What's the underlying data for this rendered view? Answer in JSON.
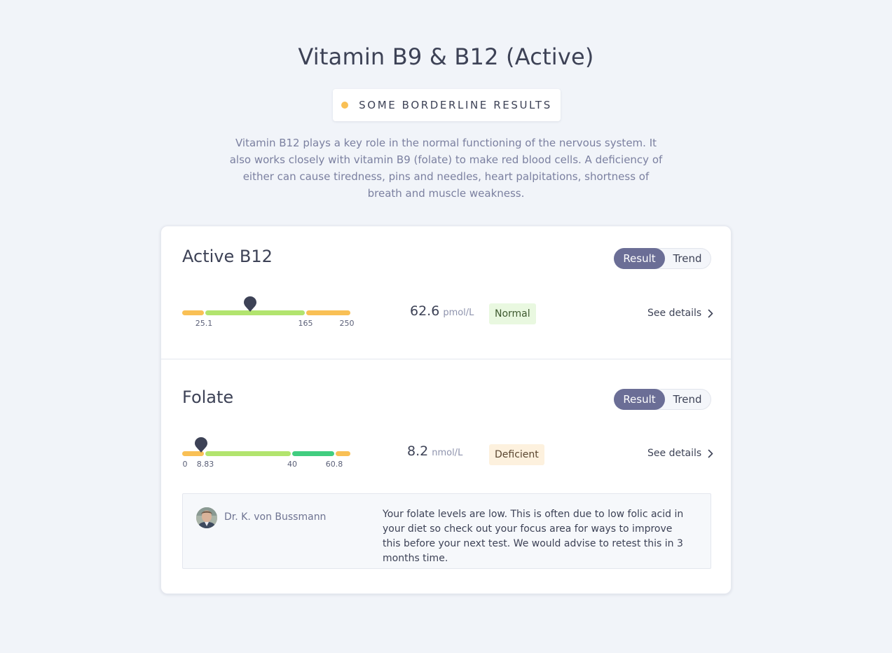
{
  "page": {
    "title": "Vitamin B9 & B12 (Active)",
    "status": {
      "label": "SOME BORDERLINE RESULTS",
      "color": "#f9c055"
    },
    "intro": "Vitamin B12 plays a key role in the normal functioning of the nervous system. It also works closely with vitamin B9 (folate) to make red blood cells. A deficiency of either can cause tiredness, pins and needles, heart palpitations, shortness of breath and muscle weakness."
  },
  "toggle": {
    "result_label": "Result",
    "trend_label": "Trend",
    "selected": "Result"
  },
  "markers": [
    {
      "name": "Active B12",
      "value": "62.6",
      "unit": "pmol/L",
      "status": "Normal",
      "see_details": "See details",
      "range_ticks": [
        "25.1",
        "165",
        "250"
      ],
      "range_bands": [
        "low-borderline",
        "normal",
        "high-borderline"
      ]
    },
    {
      "name": "Folate",
      "value": "8.2",
      "unit": "nmol/L",
      "status": "Deficient",
      "see_details": "See details",
      "range_ticks": [
        "0",
        "8.83",
        "40",
        "60.8"
      ],
      "range_bands": [
        "deficient",
        "normal",
        "optimal",
        "high-borderline"
      ]
    }
  ],
  "doctor_note": {
    "doctor": "Dr. K. von Bussmann",
    "comment": "Your folate levels are low. This is often due to low folic acid in your diet so check out your focus area for ways to improve this before your next test. We would advise to retest this in 3 months time."
  },
  "colors": {
    "borderline": "#f9c055",
    "normal": "#b2e46e",
    "optimal": "#41cd80",
    "pin": "#3d4256",
    "toggle_active": "#6b6e96"
  },
  "icons": {
    "pin": "map-pin-icon",
    "chevron": "chevron-right-icon",
    "status": "status-dot-icon"
  }
}
